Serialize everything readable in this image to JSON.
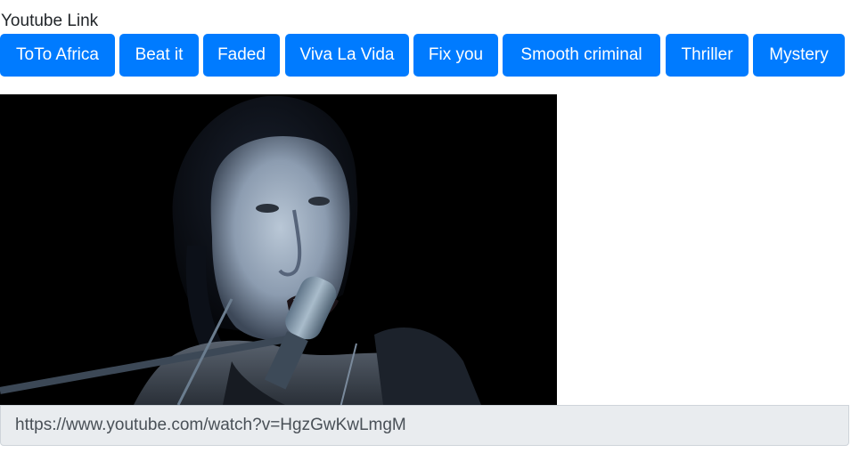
{
  "page": {
    "heading": "Youtube Link"
  },
  "song_buttons": [
    {
      "label": "ToTo Africa"
    },
    {
      "label": "Beat it"
    },
    {
      "label": "Faded"
    },
    {
      "label": "Viva La Vida"
    },
    {
      "label": "Fix you"
    },
    {
      "label": "Smooth criminal"
    },
    {
      "label": "Thriller"
    },
    {
      "label": "Mystery"
    }
  ],
  "video": {
    "description_icon": "video-frame"
  },
  "url_field": {
    "value": "https://www.youtube.com/watch?v=HgzGwKwLmgM"
  },
  "colors": {
    "button_bg": "#007bff",
    "button_text": "#ffffff",
    "field_bg": "#e9ecef"
  }
}
